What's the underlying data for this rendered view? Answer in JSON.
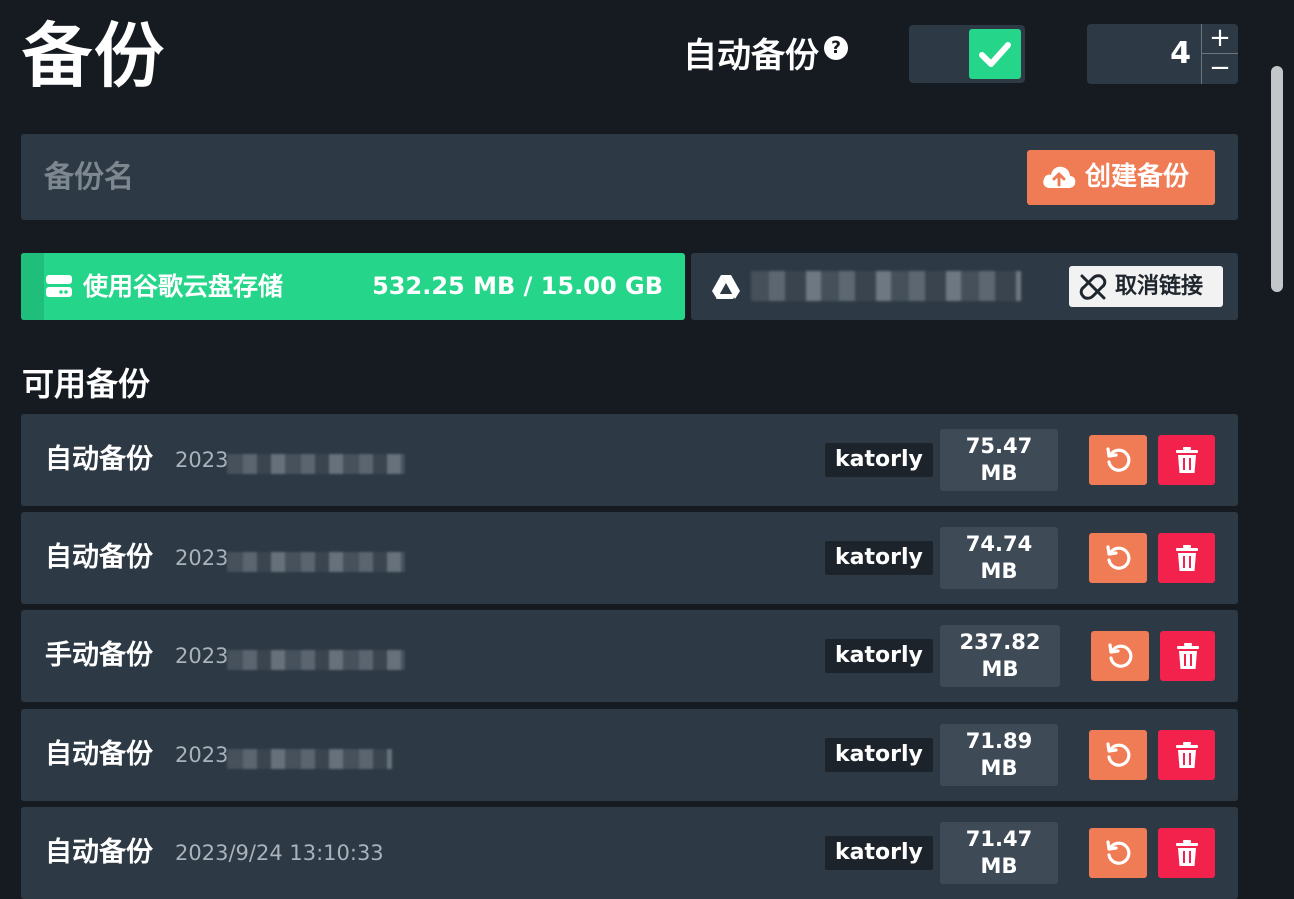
{
  "header": {
    "title": "备份",
    "auto_backup_label": "自动备份",
    "help_glyph": "?",
    "auto_backup_enabled": true,
    "keep_count": "4",
    "plus_glyph": "+",
    "minus_glyph": "−"
  },
  "create": {
    "name_placeholder": "备份名",
    "button_label": "创建备份"
  },
  "storage": {
    "label": "使用谷歌云盘存储",
    "usage": "532.25 MB / 15.00 GB"
  },
  "account": {
    "unlink_label": "取消链接"
  },
  "section_title": "可用备份",
  "backups": [
    {
      "name": "自动备份",
      "date_prefix": "2023",
      "user": "katorly",
      "size_value": "75.47",
      "size_unit": "MB"
    },
    {
      "name": "自动备份",
      "date_prefix": "2023",
      "user": "katorly",
      "size_value": "74.74",
      "size_unit": "MB"
    },
    {
      "name": "手动备份",
      "date_prefix": "2023",
      "user": "katorly",
      "size_value": "237.82",
      "size_unit": "MB"
    },
    {
      "name": "自动备份",
      "date_prefix": "2023",
      "user": "katorly",
      "size_value": "71.89",
      "size_unit": "MB"
    },
    {
      "name": "自动备份",
      "date_prefix": "2023/9/24 13:10:33",
      "user": "katorly",
      "size_value": "71.47",
      "size_unit": "MB"
    }
  ],
  "colors": {
    "background": "#161b22",
    "panel": "#2d3944",
    "accent_green": "#25d58a",
    "accent_orange": "#f07c55",
    "danger_red": "#f2224d"
  },
  "icons": [
    "help-icon",
    "check-icon",
    "plus-icon",
    "minus-icon",
    "cloud-upload-icon",
    "hard-drive-icon",
    "google-drive-icon",
    "unlink-icon",
    "restore-icon",
    "trash-icon"
  ]
}
